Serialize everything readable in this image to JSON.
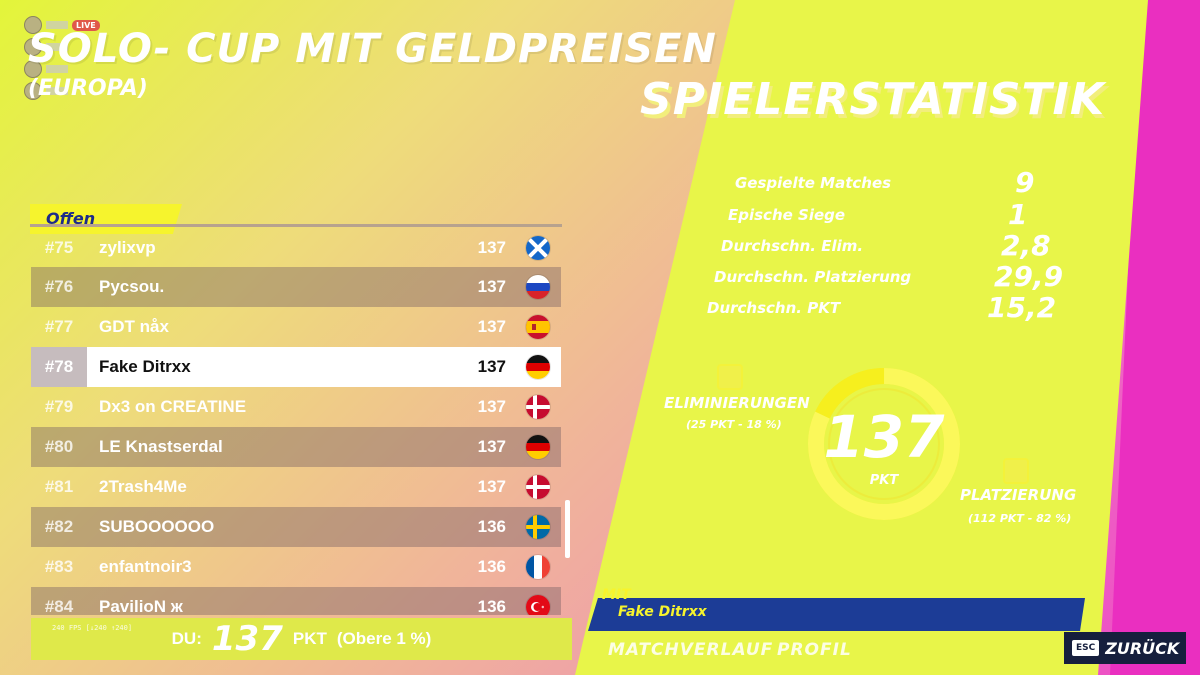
{
  "overlay": {
    "live_badge": "LIVE"
  },
  "event": {
    "title": "SOLO- CUP MIT GELDPREISEN",
    "subtitle": "(EUROPA)"
  },
  "stats_heading": "SPIELERSTATISTIK",
  "leaderboard": {
    "filter_tab": "Offen",
    "rows": [
      {
        "rank": "#75",
        "name": "zylixvp",
        "points": "137",
        "flag": "scotland"
      },
      {
        "rank": "#76",
        "name": "Pycsou.",
        "points": "137",
        "flag": "russia"
      },
      {
        "rank": "#77",
        "name": "GDT nåx",
        "points": "137",
        "flag": "spain"
      },
      {
        "rank": "#78",
        "name": "Fake Ditrxx",
        "points": "137",
        "flag": "germany"
      },
      {
        "rank": "#79",
        "name": "Dx3 on CREATINE",
        "points": "137",
        "flag": "denmark"
      },
      {
        "rank": "#80",
        "name": "LE Knastserdal",
        "points": "137",
        "flag": "germany"
      },
      {
        "rank": "#81",
        "name": "2Trash4Me",
        "points": "137",
        "flag": "denmark"
      },
      {
        "rank": "#82",
        "name": "SUBOOOOOO",
        "points": "136",
        "flag": "sweden"
      },
      {
        "rank": "#83",
        "name": "enfantnoir3",
        "points": "136",
        "flag": "france"
      },
      {
        "rank": "#84",
        "name": "PavilioN ж",
        "points": "136",
        "flag": "turkey"
      }
    ]
  },
  "you": {
    "label": "DU:",
    "points": "137",
    "unit": "PKT",
    "note": "(Obere 1 %)"
  },
  "fps": "240 FPS [↓240 ↑240]",
  "stats": [
    {
      "label": "Gespielte Matches",
      "value": "9"
    },
    {
      "label": "Epische Siege",
      "value": "1"
    },
    {
      "label": "Durchschn. Elim.",
      "value": "2,8"
    },
    {
      "label": "Durchschn. Platzierung",
      "value": "29,9"
    },
    {
      "label": "Durchschn. PKT",
      "value": "15,2"
    }
  ],
  "breakdown": {
    "total": "137",
    "unit": "PKT",
    "eliminations_label": "ELIMINIERUNGEN",
    "eliminations_sub": "(25 PKT - 18 %)",
    "eliminations_fraction": 0.18,
    "placement_label": "PLATZIERUNG",
    "placement_sub": "(112 PKT - 82 %)",
    "placement_fraction": 0.82
  },
  "party": {
    "with_label": "MIT",
    "member": "Fake Ditrxx"
  },
  "tabs": {
    "match_history": "MATCHVERLAUF",
    "profile": "PROFIL"
  },
  "back": {
    "key": "ESC",
    "label": "ZURÜCK"
  },
  "colors": {
    "accent_yellow": "#f6f42d",
    "highlight_row": "#ffffff",
    "party_blue": "#1c3c96",
    "back_btn": "#161f3d"
  }
}
